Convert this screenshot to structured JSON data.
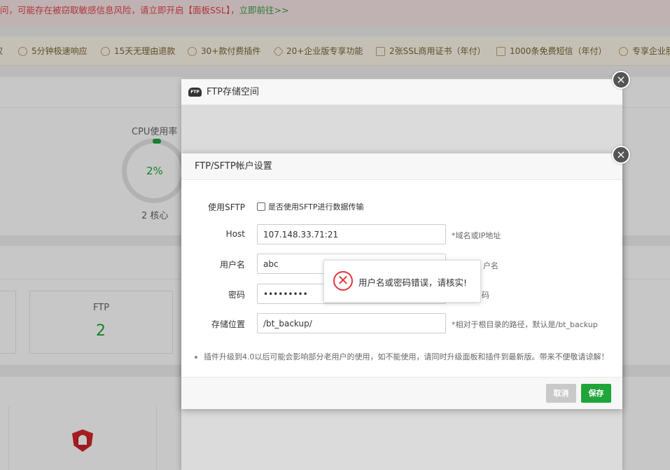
{
  "warning": {
    "text": "问，可能存在被窃取敏感信息风险，请立即开启【面板SSL】，",
    "link": "立即前往>>"
  },
  "features": [
    {
      "icon": "crown-icon",
      "label": "权"
    },
    {
      "icon": "clock-icon",
      "label": "5分钟极速响应"
    },
    {
      "icon": "refund-icon",
      "label": "15天无理由退款"
    },
    {
      "icon": "plugin-icon",
      "label": "30+款付费插件"
    },
    {
      "icon": "diamond-icon",
      "label": "20+企业版专享功能"
    },
    {
      "icon": "ssl-icon",
      "label": "2张SSL商用证书（年付）"
    },
    {
      "icon": "mail-icon",
      "label": "1000条免费短信（年付）"
    },
    {
      "icon": "heart-icon",
      "label": "专享企业服"
    }
  ],
  "dashboard": {
    "cpu_label": "CPU使用率",
    "cpu_value": "2%",
    "cpu_usage_fraction": 0.02,
    "cpu_cores": "2 核心",
    "ftp_title": "FTP",
    "ftp_count": "2"
  },
  "outer_dialog": {
    "title": "FTP存储空间",
    "badge": "FTP",
    "close": "×"
  },
  "inner_dialog": {
    "title": "FTP/SFTP帐户设置",
    "close": "×",
    "sftp": {
      "label": "使用SFTP",
      "checkbox_label": "是否使用SFTP进行数据传输",
      "checked": false
    },
    "host": {
      "label": "Host",
      "value": "107.148.33.71:21",
      "hint": "*域名或IP地址"
    },
    "username": {
      "label": "用户名",
      "value": "abc",
      "hint": "户名"
    },
    "password": {
      "label": "密码",
      "value": "abcdefghi",
      "hint": "码"
    },
    "storage": {
      "label": "存储位置",
      "value": "/bt_backup/",
      "hint": "*相对于根目录的路径，默认是/bt_backup"
    },
    "note": "插件升级到4.0以后可能会影响部分老用户的使用，如不能使用，请同时升级面板和插件到最新版。带来不便敬请谅解！",
    "cancel_label": "取消",
    "save_label": "保存"
  },
  "toast": {
    "message": "用户名或密码错误，请核实!",
    "icon": "error-icon"
  },
  "colors": {
    "accent": "#20a53a",
    "error": "#e0363b",
    "warning_text": "#e0464e"
  }
}
